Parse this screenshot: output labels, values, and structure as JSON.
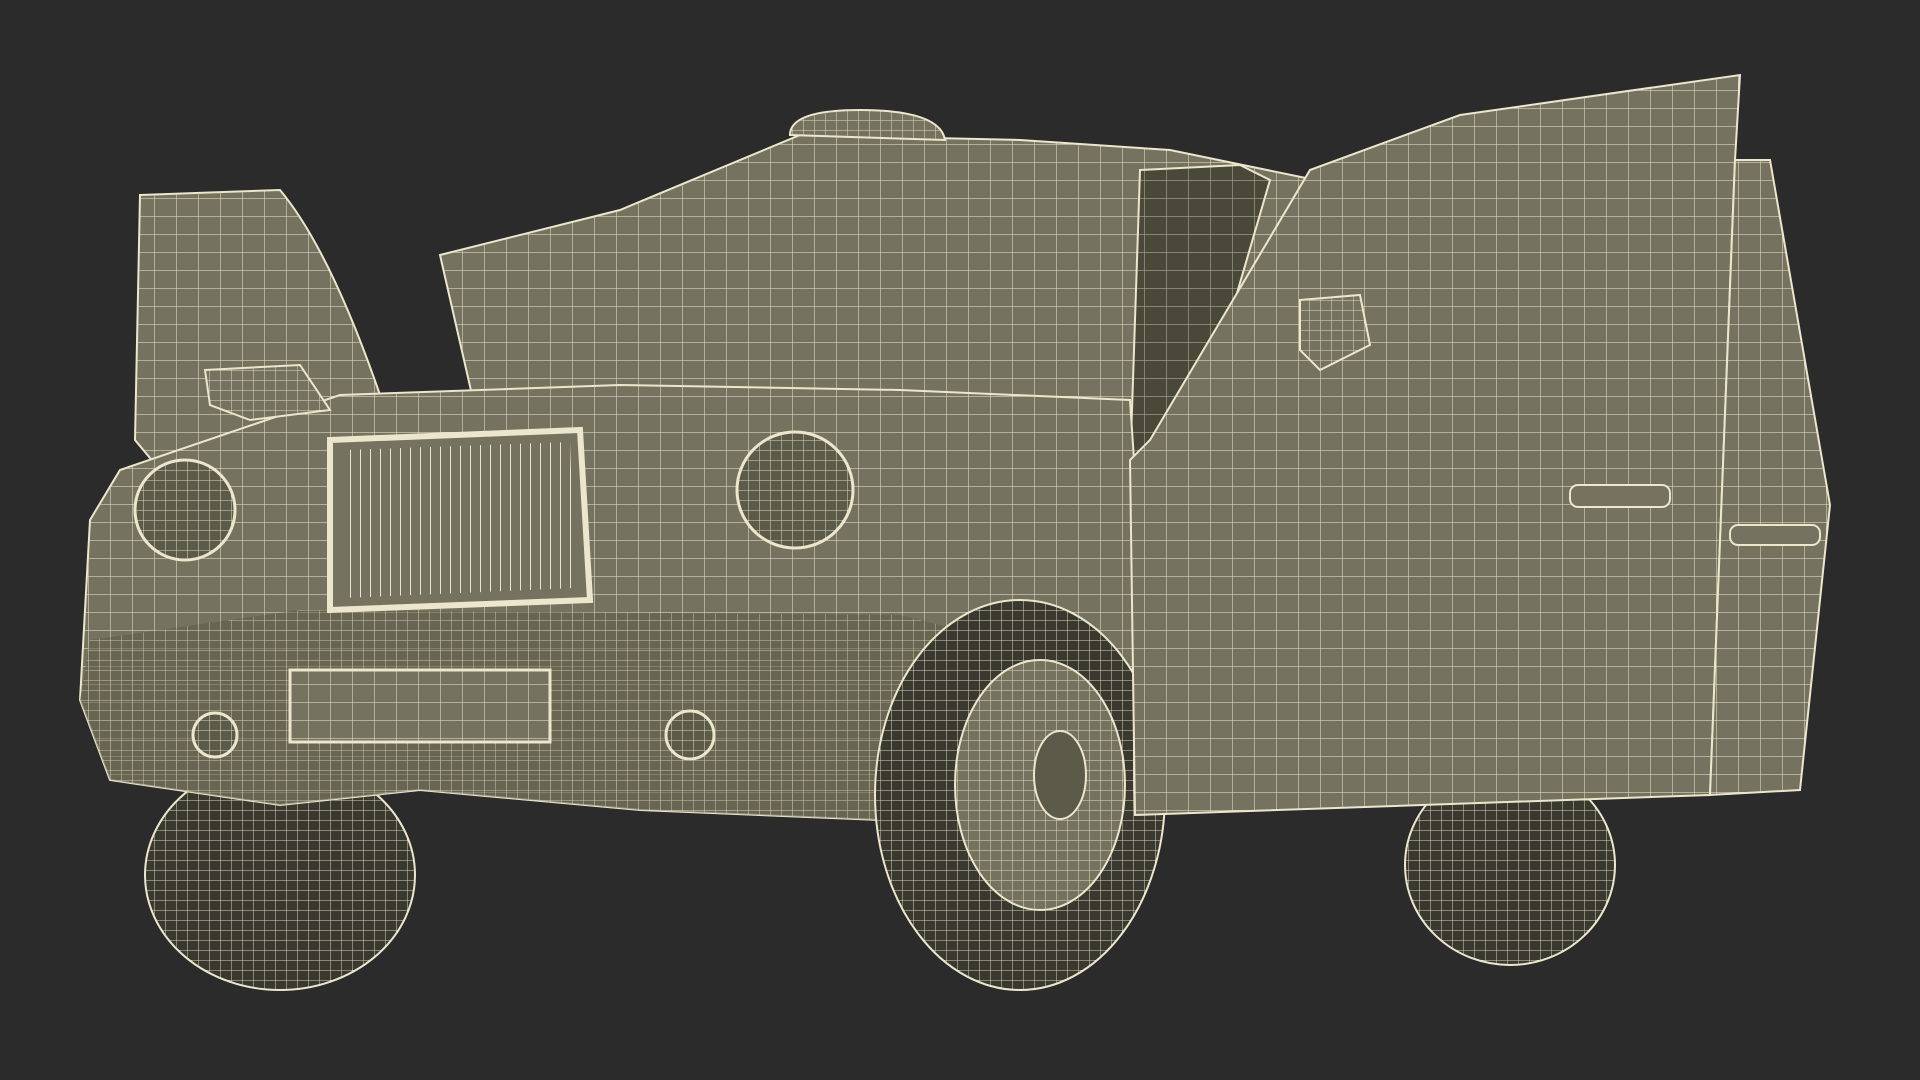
{
  "scene": {
    "background_color": "#2b2b2b",
    "body_color": "#75735f",
    "body_shadow_color": "#5c5a49",
    "interior_color": "#4a4939",
    "wire_color": "#ece6cc",
    "tyre_color": "#3a392f",
    "subject": "wireframe-3d-model"
  }
}
